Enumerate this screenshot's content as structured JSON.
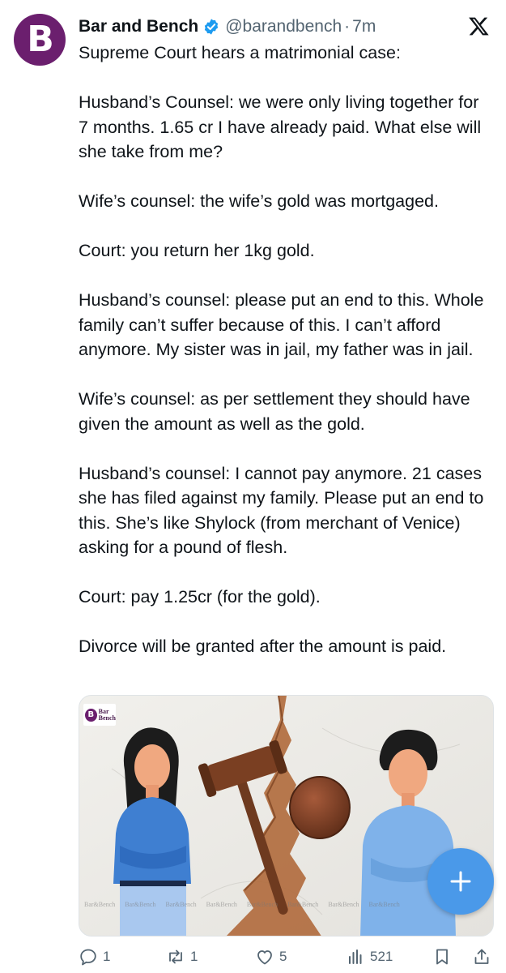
{
  "tweet": {
    "author_name": "Bar and Bench",
    "handle": "@barandbench",
    "separator": "·",
    "time": "7m",
    "avatar_letter": "B",
    "paragraphs": [
      "Supreme Court hears a matrimonial case:",
      "Husband’s Counsel: we were only living together for 7 months. 1.65 cr I have already paid. What else will she take from me?",
      "Wife’s counsel: the wife’s gold was mortgaged.",
      "Court: you return her 1kg gold.",
      "Husband’s counsel: please put an end to this. Whole family can’t suffer because of this. I can’t afford anymore. My sister was in jail, my father was in jail.",
      "Wife’s counsel: as per settlement they should have given the amount as well as the gold.",
      "Husband’s counsel: I cannot pay anymore. 21 cases she has filed against my family. Please put an end to this. She’s like Shylock (from merchant of Venice) asking for a pound of flesh.",
      "Court: pay 1.25cr (for the gold).",
      "Divorce will be granted after the amount is paid."
    ]
  },
  "media": {
    "logo_letter": "B",
    "logo_text_line1": "Bar",
    "logo_text_line2": "Bench",
    "watermark_text": "Bar&Bench"
  },
  "actions": {
    "reply_count": "1",
    "retweet_count": "1",
    "like_count": "5",
    "views_count": "521"
  },
  "icons": {
    "verified": "verified-badge-icon",
    "platform": "x-logo-icon",
    "compose": "plus-icon",
    "reply": "reply-icon",
    "retweet": "retweet-icon",
    "like": "heart-icon",
    "views": "views-icon",
    "bookmark": "bookmark-icon",
    "share": "share-icon"
  },
  "colors": {
    "brand": "#6b1f6e",
    "verified": "#1d9bf0",
    "fab": "#4a99e9",
    "muted": "#536471"
  }
}
